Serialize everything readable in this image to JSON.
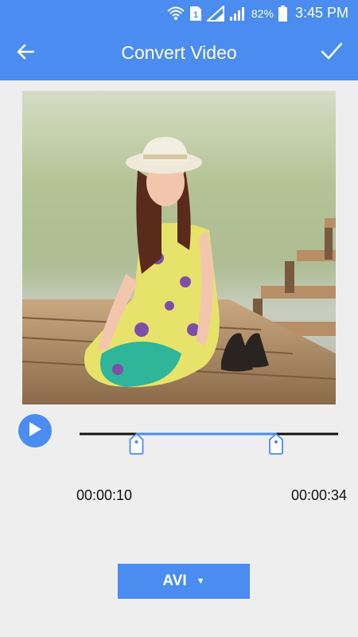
{
  "status_bar": {
    "battery_percent": "82%",
    "time": "3:45 PM",
    "sim_label": "1",
    "icons": [
      "wifi-icon",
      "sim-icon",
      "signal-icon",
      "signal-icon",
      "battery-icon"
    ]
  },
  "header": {
    "title": "Convert Video",
    "back_icon": "arrow-left-icon",
    "confirm_icon": "check-icon"
  },
  "player": {
    "play_icon": "play-icon",
    "trim_start_fraction": 0.22,
    "trim_end_fraction": 0.76,
    "start_time": "00:00:10",
    "end_time": "00:00:34"
  },
  "format": {
    "selected": "AVI",
    "dropdown_icon": "caret-down-icon",
    "caret": "▼"
  },
  "colors": {
    "accent": "#4a8cf0",
    "background": "#eeeeee",
    "track": "#111111"
  }
}
